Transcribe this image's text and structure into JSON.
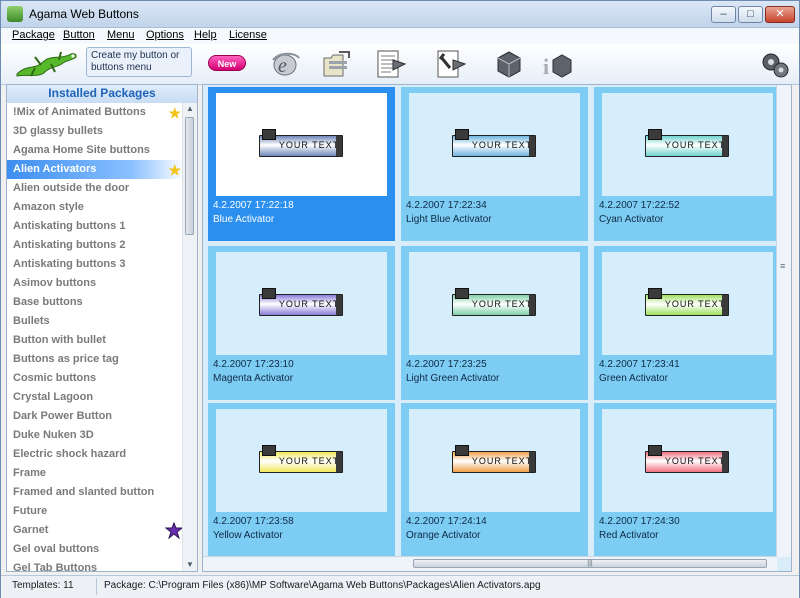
{
  "window": {
    "title": "Agama Web Buttons",
    "minimize": "–",
    "maximize": "□",
    "close": "✕"
  },
  "menu": [
    "Package",
    "Button",
    "Menu",
    "Options",
    "Help",
    "License"
  ],
  "toolbar": {
    "hint": "Create my button or buttons menu",
    "new_label": "New",
    "icons": [
      "internet-explorer-icon",
      "export-icon",
      "button-script-icon",
      "button-tools-icon",
      "3d-box-icon",
      "info-box-icon",
      "gears-icon"
    ]
  },
  "left_panel": {
    "header": "Installed Packages",
    "selected_index": 3,
    "items": [
      "!Mix of Animated Buttons",
      "3D glassy bullets",
      "Agama Home Site buttons",
      "Alien Activators",
      "Alien outside the door",
      "Amazon style",
      "Antiskating buttons 1",
      "Antiskating buttons 2",
      "Antiskating buttons 3",
      "Asimov buttons",
      "Base buttons",
      "Bullets",
      "Button with bullet",
      "Buttons as price tag",
      "Cosmic buttons",
      "Crystal Lagoon",
      "Dark Power Button",
      "Duke Nuken 3D",
      "Electric shock hazard",
      "Frame",
      "Framed and slanted button",
      "Future",
      "Garnet",
      "Gel oval buttons",
      "Gel Tab Buttons"
    ],
    "starred": [
      0,
      3
    ],
    "badge_index": 22,
    "badge_icon": "new-star-icon"
  },
  "templates": {
    "preview_text": "YOUR TEXT",
    "selected_index": 0,
    "items": [
      {
        "date": "4.2.2007 17:22:18",
        "name": "Blue Activator",
        "color": "#6f86b8"
      },
      {
        "date": "4.2.2007 17:22:34",
        "name": "Light Blue Activator",
        "color": "#6fb4e0"
      },
      {
        "date": "4.2.2007 17:22:52",
        "name": "Cyan Activator",
        "color": "#6fd3cf"
      },
      {
        "date": "4.2.2007 17:23:10",
        "name": "Magenta Activator",
        "color": "#8b7bd8"
      },
      {
        "date": "4.2.2007 17:23:25",
        "name": "Light Green Activator",
        "color": "#7fd0a8"
      },
      {
        "date": "4.2.2007 17:23:41",
        "name": "Green Activator",
        "color": "#9ee060"
      },
      {
        "date": "4.2.2007 17:23:58",
        "name": "Yellow Activator",
        "color": "#f0e85a"
      },
      {
        "date": "4.2.2007 17:24:14",
        "name": "Orange Activator",
        "color": "#f0a04a"
      },
      {
        "date": "4.2.2007 17:24:30",
        "name": "Red Activator",
        "color": "#f07080"
      }
    ]
  },
  "status": {
    "templates": "Templates: 11",
    "package": "Package: C:\\Program Files (x86)\\MP Software\\Agama Web Buttons\\Packages\\Alien Activators.apg"
  }
}
